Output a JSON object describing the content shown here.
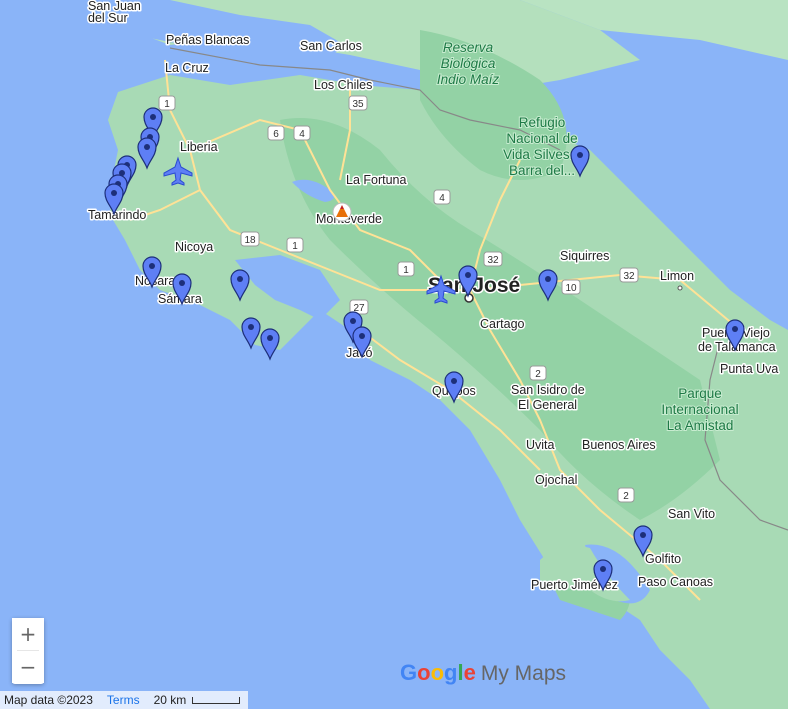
{
  "map": {
    "places": [
      {
        "id": "san-juan",
        "text": "San Juan"
      },
      {
        "id": "del-sur",
        "text": "del Sur"
      },
      {
        "id": "penas-blancas",
        "text": "Peñas Blancas"
      },
      {
        "id": "san-carlos",
        "text": "San Carlos"
      },
      {
        "id": "la-cruz",
        "text": "La Cruz"
      },
      {
        "id": "los-chiles",
        "text": "Los Chiles"
      },
      {
        "id": "liberia",
        "text": "Liberia"
      },
      {
        "id": "la-fortuna",
        "text": "La Fortuna"
      },
      {
        "id": "tamarindo",
        "text": "Tamarindo"
      },
      {
        "id": "monteverde",
        "text": "Monteverde"
      },
      {
        "id": "nicoya",
        "text": "Nicoya"
      },
      {
        "id": "nosara",
        "text": "Nosara"
      },
      {
        "id": "samara",
        "text": "Sámara"
      },
      {
        "id": "jaco",
        "text": "Jacó"
      },
      {
        "id": "quepos",
        "text": "Quepos"
      },
      {
        "id": "san-jose",
        "text": "San José"
      },
      {
        "id": "cartago",
        "text": "Cartago"
      },
      {
        "id": "siquirres",
        "text": "Siquirres"
      },
      {
        "id": "limon",
        "text": "Limon"
      },
      {
        "id": "puerto-viejo-1",
        "text": "Puerto Viejo"
      },
      {
        "id": "puerto-viejo-2",
        "text": "de Talamanca"
      },
      {
        "id": "punta-uva",
        "text": "Punta Uva"
      },
      {
        "id": "san-isidro-1",
        "text": "San Isidro de"
      },
      {
        "id": "san-isidro-2",
        "text": "El General"
      },
      {
        "id": "uvita",
        "text": "Uvita"
      },
      {
        "id": "buenos-aires",
        "text": "Buenos Aires"
      },
      {
        "id": "ojochal",
        "text": "Ojochal"
      },
      {
        "id": "san-vito",
        "text": "San Vito"
      },
      {
        "id": "golfito",
        "text": "Golfito"
      },
      {
        "id": "puerto-jimenez",
        "text": "Puerto Jiménez"
      },
      {
        "id": "paso-canoas",
        "text": "Paso Canoas"
      }
    ],
    "parks": [
      {
        "id": "indio-maiz-1",
        "text": "Reserva"
      },
      {
        "id": "indio-maiz-2",
        "text": "Biológica"
      },
      {
        "id": "indio-maiz-3",
        "text": "Indio Maíz"
      },
      {
        "id": "refugio-1",
        "text": "Refugio"
      },
      {
        "id": "refugio-2",
        "text": "Nacional de"
      },
      {
        "id": "refugio-3",
        "text": "Vida Silves..."
      },
      {
        "id": "refugio-4",
        "text": "Barra del..."
      },
      {
        "id": "amistad-1",
        "text": "Parque"
      },
      {
        "id": "amistad-2",
        "text": "Internacional"
      },
      {
        "id": "amistad-3",
        "text": "La Amistad"
      }
    ],
    "route_shields": [
      "1",
      "35",
      "6",
      "4",
      "4",
      "18",
      "1",
      "1",
      "27",
      "32",
      "32",
      "10",
      "2",
      "2"
    ]
  },
  "zoom": {
    "in_label": "+",
    "out_label": "−"
  },
  "attribution": {
    "map_data": "Map data ©2023",
    "terms": "Terms",
    "scale": "20 km"
  },
  "brand": {
    "google": "Google",
    "product": "My Maps"
  },
  "colors": {
    "water": "#8ab4f8",
    "land": "#a8dab5",
    "forest": "#93d2a5",
    "pin": "#5e7ff5",
    "road": "#ffe296"
  }
}
